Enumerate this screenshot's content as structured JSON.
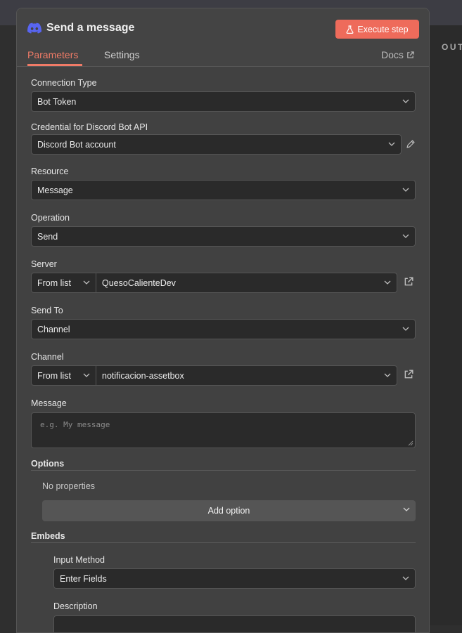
{
  "background_right": {
    "label": "OUT"
  },
  "header": {
    "title": "Send a message",
    "execute_label": "Execute step",
    "tabs": {
      "parameters": "Parameters",
      "settings": "Settings"
    },
    "docs_label": "Docs"
  },
  "fields": {
    "connection_type": {
      "label": "Connection Type",
      "value": "Bot Token"
    },
    "credential": {
      "label": "Credential for Discord Bot API",
      "value": "Discord Bot account"
    },
    "resource": {
      "label": "Resource",
      "value": "Message"
    },
    "operation": {
      "label": "Operation",
      "value": "Send"
    },
    "server": {
      "label": "Server",
      "mode": "From list",
      "value": "QuesoCalienteDev"
    },
    "send_to": {
      "label": "Send To",
      "value": "Channel"
    },
    "channel": {
      "label": "Channel",
      "mode": "From list",
      "value": "notificacion-assetbox"
    },
    "message": {
      "label": "Message",
      "placeholder": "e.g. My message"
    }
  },
  "options": {
    "title": "Options",
    "empty_text": "No properties",
    "add_label": "Add option"
  },
  "embeds": {
    "title": "Embeds",
    "input_method": {
      "label": "Input Method",
      "value": "Enter Fields"
    },
    "description_label": "Description"
  },
  "colors": {
    "accent": "#ee6b5b",
    "tab_active": "#f07b67",
    "discord": "#5865F2"
  }
}
